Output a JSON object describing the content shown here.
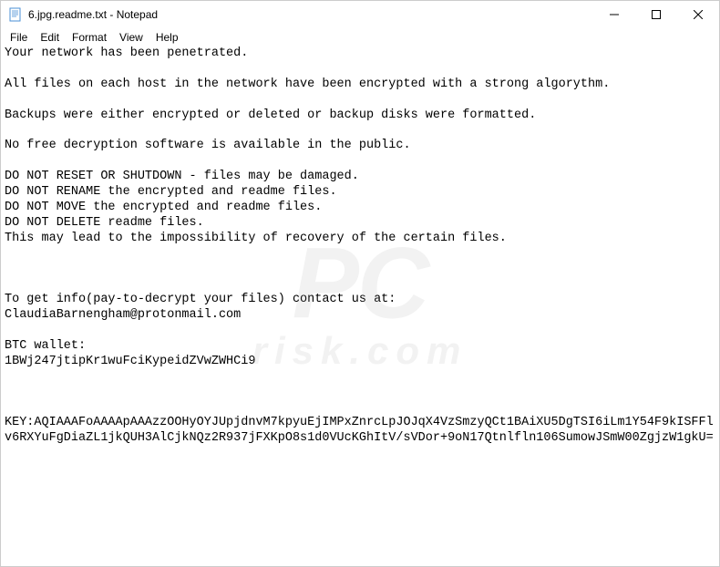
{
  "window": {
    "title": "6.jpg.readme.txt - Notepad"
  },
  "menu": {
    "file": "File",
    "edit": "Edit",
    "format": "Format",
    "view": "View",
    "help": "Help"
  },
  "content": {
    "text": "Your network has been penetrated.\n\nAll files on each host in the network have been encrypted with a strong algorythm.\n\nBackups were either encrypted or deleted or backup disks were formatted.\n\nNo free decryption software is available in the public.\n\nDO NOT RESET OR SHUTDOWN - files may be damaged.\nDO NOT RENAME the encrypted and readme files.\nDO NOT MOVE the encrypted and readme files.\nDO NOT DELETE readme files.\nThis may lead to the impossibility of recovery of the certain files.\n\n\n\nTo get info(pay-to-decrypt your files) contact us at:\nClaudiaBarnengham@protonmail.com\n\nBTC wallet:\n1BWj247jtipKr1wuFciKypeidZVwZWHCi9\n\n\n\nKEY:AQIAAAFoAAAApAAAzzOOHyOYJUpjdnvM7kpyuEjIMPxZnrcLpJOJqX4VzSmzyQCt1BAiXU5DgTSI6iLm1Y54F9kISFFlv6RXYuFgDiaZL1jkQUH3AlCjkNQz2R937jFXKpO8s1d0VUcKGhItV/sVDor+9oN17Qtnlfln106SumowJSmW00ZgjzW1gkU="
  },
  "watermark": {
    "main": "PC",
    "sub": "risk.com"
  }
}
